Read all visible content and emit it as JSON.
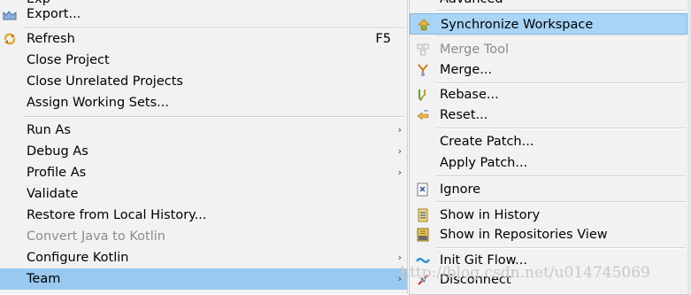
{
  "left_menu": {
    "partial_top_label": "Exp",
    "items": [
      {
        "label": "Export...",
        "icon": "export-icon"
      },
      {
        "label": "Refresh",
        "accel": "F5",
        "icon": "refresh-icon"
      },
      {
        "label": "Close Project"
      },
      {
        "label": "Close Unrelated Projects"
      },
      {
        "label": "Assign Working Sets..."
      },
      {
        "label": "Run As",
        "submenu": true
      },
      {
        "label": "Debug As",
        "submenu": true
      },
      {
        "label": "Profile As",
        "submenu": true
      },
      {
        "label": "Validate"
      },
      {
        "label": "Restore from Local History..."
      },
      {
        "label": "Convert Java to Kotlin",
        "disabled": true
      },
      {
        "label": "Configure Kotlin",
        "submenu": true
      },
      {
        "label": "Team",
        "submenu": true,
        "selected": true
      }
    ],
    "arrow_glyph": "›"
  },
  "right_menu": {
    "partial_top_label": "Advanced",
    "items": [
      {
        "label": "Synchronize Workspace",
        "icon": "synchronize-icon",
        "highlighted": true
      },
      {
        "label": "Merge Tool",
        "icon": "merge-tool-icon",
        "disabled": true
      },
      {
        "label": "Merge...",
        "icon": "merge-icon"
      },
      {
        "label": "Rebase...",
        "icon": "rebase-icon"
      },
      {
        "label": "Reset...",
        "icon": "reset-icon"
      },
      {
        "label": "Create Patch..."
      },
      {
        "label": "Apply Patch..."
      },
      {
        "label": "Ignore",
        "icon": "ignore-icon"
      },
      {
        "label": "Show in History",
        "icon": "history-icon"
      },
      {
        "label": "Show in Repositories View",
        "icon": "git-repository-icon"
      },
      {
        "label": "Init Git Flow...",
        "icon": "git-flow-icon"
      },
      {
        "label": "Disconnect",
        "icon": "disconnect-icon"
      }
    ]
  },
  "watermark": "http://blog.csdn.net/u014745069",
  "colors": {
    "menu_background": "#f2f2f2",
    "selected_background": "#99c9ef",
    "highlight_background": "#a8d4f6",
    "disabled_text": "#8c8c8c"
  }
}
